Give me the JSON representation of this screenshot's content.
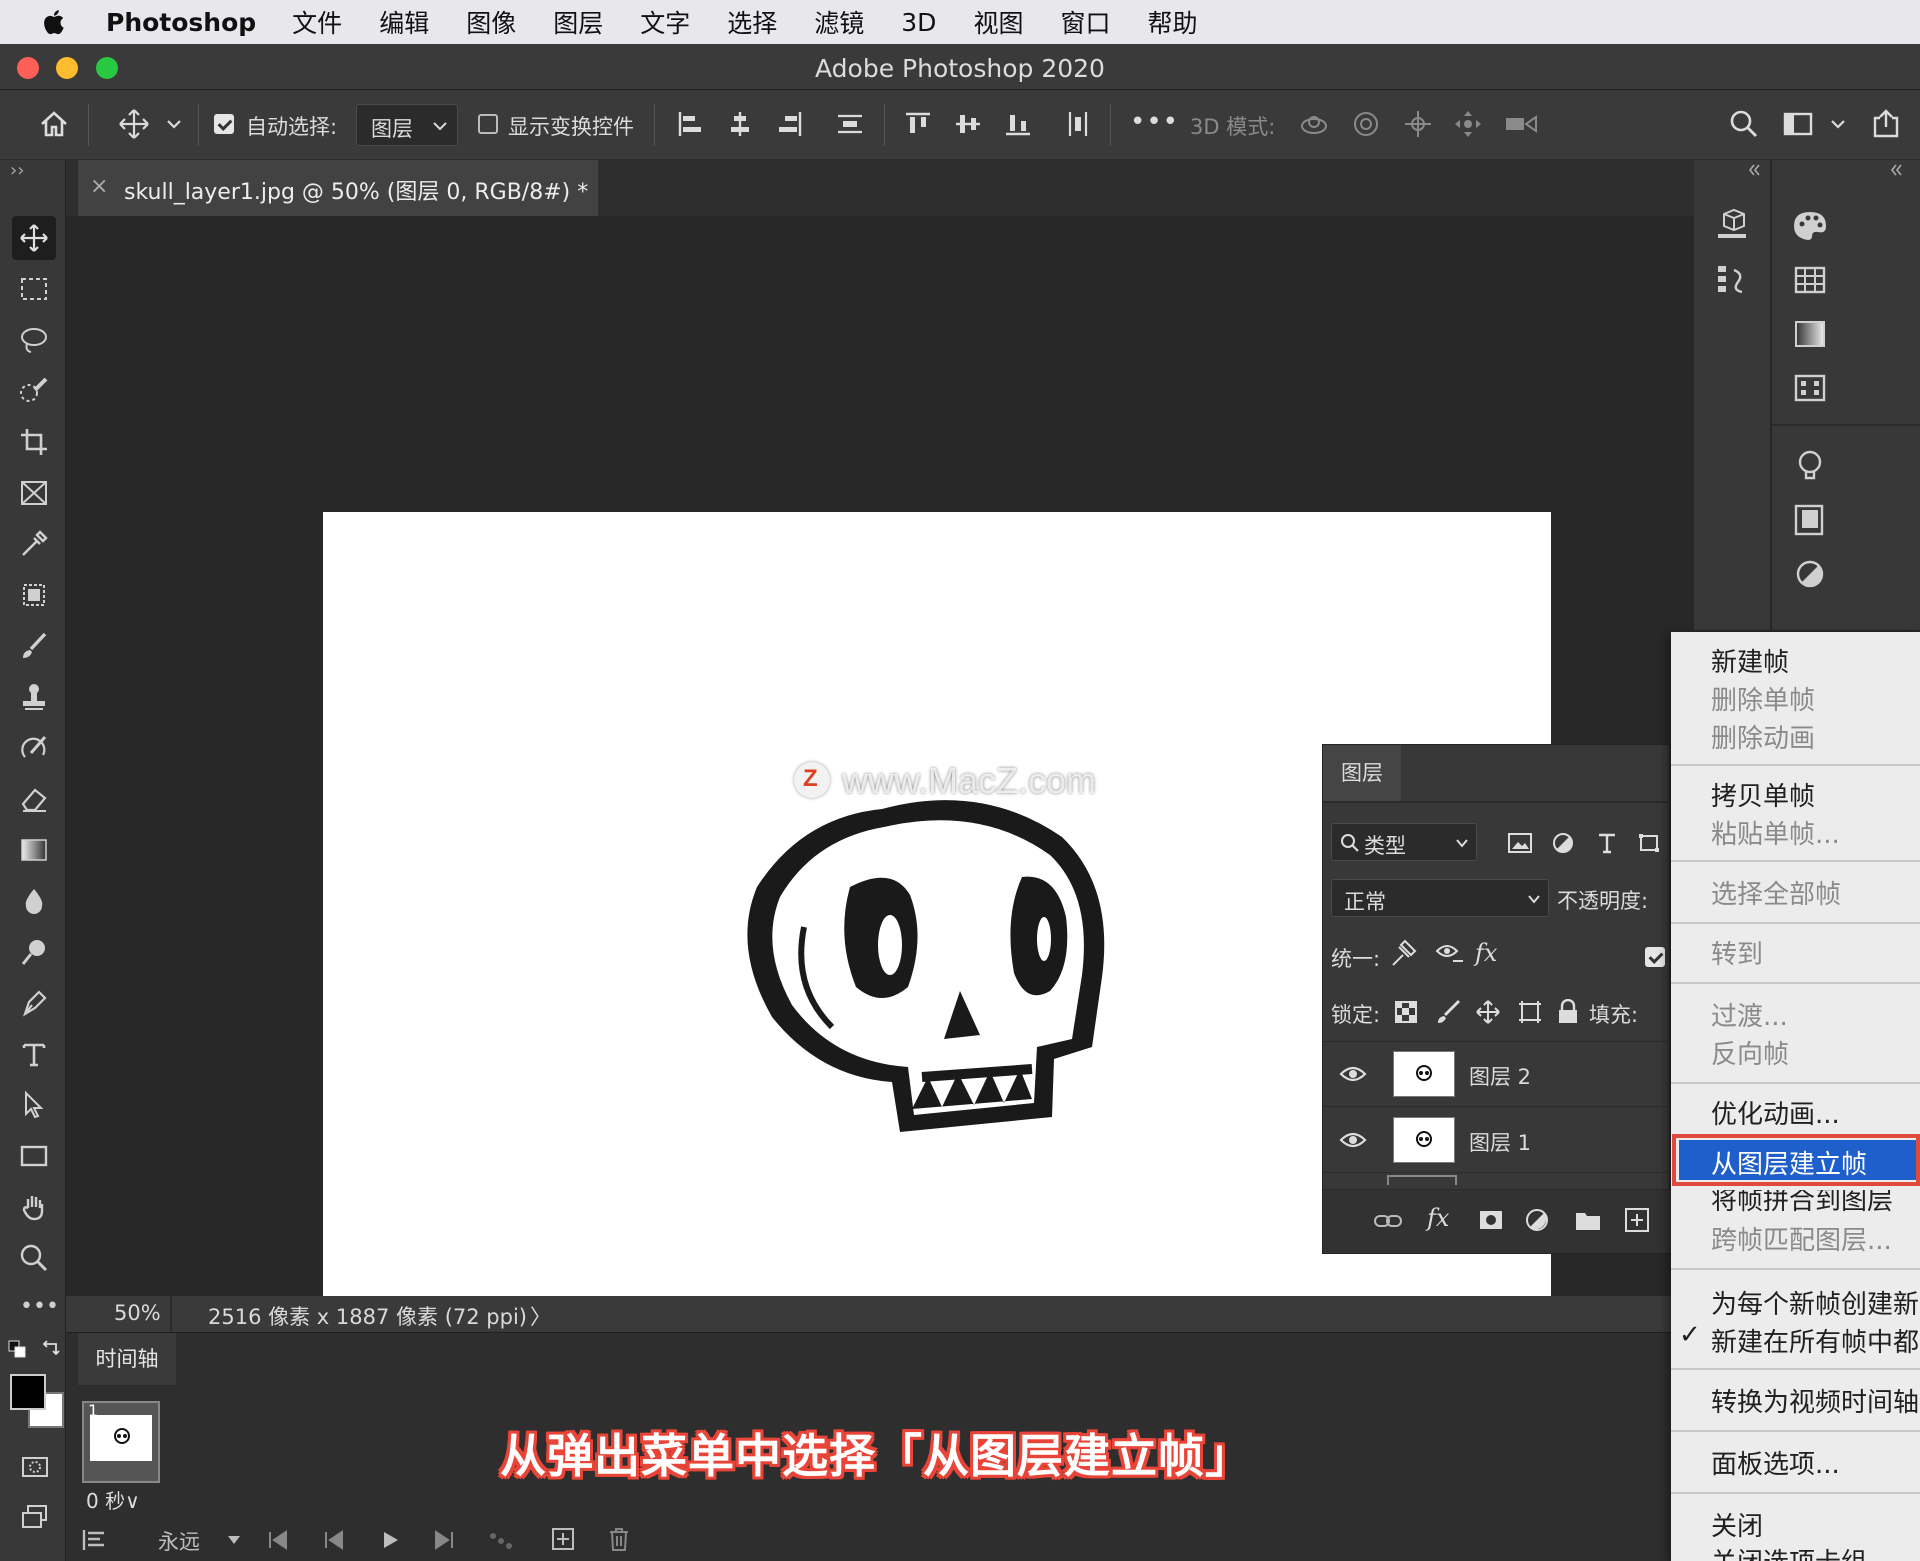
{
  "menubar": {
    "app_name": "Photoshop",
    "items": [
      "文件",
      "编辑",
      "图像",
      "图层",
      "文字",
      "选择",
      "滤镜",
      "3D",
      "视图",
      "窗口",
      "帮助"
    ]
  },
  "window": {
    "title": "Adobe Photoshop 2020"
  },
  "options_bar": {
    "auto_select_label": "自动选择:",
    "auto_select_checked": true,
    "auto_select_target": "图层",
    "show_transform_label": "显示变换控件",
    "show_transform_checked": false,
    "more_label": "•••",
    "mode_3d_label": "3D 模式:"
  },
  "document_tab": {
    "close_glyph": "×",
    "title": "skull_layer1.jpg @ 50% (图层 0, RGB/8#) *"
  },
  "tools_panel": {
    "collapse_glyph": "››",
    "more_glyph": "•••"
  },
  "canvas": {
    "watermark_text": "www.MacZ.com"
  },
  "status_bar": {
    "zoom": "50%",
    "doc_info": "2516 像素 x 1887 像素 (72 ppi)",
    "arrow": "〉"
  },
  "timeline": {
    "tab_label": "时间轴",
    "frame_number": "1",
    "frame_delay": "0 秒∨",
    "loop_label": "永远"
  },
  "caption": "从弹出菜单中选择「从图层建立帧」",
  "layers_panel": {
    "tab_label": "图层",
    "filter_kind": "类型",
    "blend_mode": "正常",
    "opacity_label": "不透明度:",
    "unify_label": "统一:",
    "lock_label": "锁定:",
    "fill_label": "填充:",
    "layers": [
      {
        "name": "图层 2",
        "visible": true
      },
      {
        "name": "图层 1",
        "visible": true
      }
    ]
  },
  "flyout_menu": {
    "items": [
      {
        "label": "新建帧",
        "enabled": true
      },
      {
        "label": "删除单帧",
        "enabled": false
      },
      {
        "label": "删除动画",
        "enabled": false
      },
      {
        "label": "拷贝单帧",
        "enabled": true
      },
      {
        "label": "粘贴单帧...",
        "enabled": false
      },
      {
        "label": "选择全部帧",
        "enabled": false
      },
      {
        "label": "转到",
        "enabled": false
      },
      {
        "label": "过渡...",
        "enabled": false
      },
      {
        "label": "反向帧",
        "enabled": false
      },
      {
        "label": "优化动画...",
        "enabled": true
      },
      {
        "label": "从图层建立帧",
        "enabled": true,
        "highlighted": true
      },
      {
        "label": "将帧拼合到图层",
        "enabled": true
      },
      {
        "label": "跨帧匹配图层...",
        "enabled": false
      },
      {
        "label": "为每个新帧创建新",
        "enabled": true
      },
      {
        "label": "新建在所有帧中都",
        "enabled": true,
        "checked": true
      },
      {
        "label": "转换为视频时间轴",
        "enabled": true
      },
      {
        "label": "面板选项...",
        "enabled": true
      },
      {
        "label": "关闭",
        "enabled": true
      },
      {
        "label": "关闭选项卡组",
        "enabled": true
      }
    ],
    "check_glyph": "✓"
  },
  "colors": {
    "menu_highlight": "#1f5fcc",
    "annotation_red": "#e04a3c",
    "panel_bg": "#383838",
    "canvas_bg": "#282828"
  }
}
